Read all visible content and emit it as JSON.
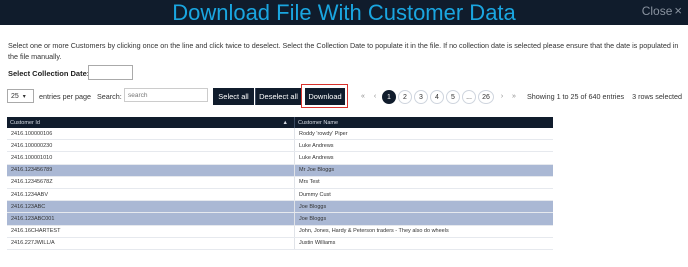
{
  "title": "Download File With Customer Data",
  "close_label": "Close",
  "intro_text": "Select one or more Customers by clicking once on the line and click twice to deselect. Select the Collection Date to populate it in the file. If no collection date is selected please ensure that the date is populated in the file manually.",
  "collection_date_label": "Select Collection Date:",
  "collection_date_value": "",
  "page_length": "25",
  "entries_per_page_label": "entries per page",
  "search_label": "Search:",
  "search_placeholder": "search",
  "buttons": {
    "select_all": "Select all",
    "deselect_all": "Deselect all",
    "download": "Download"
  },
  "pagination": {
    "first": "«",
    "prev": "‹",
    "pages": [
      "1",
      "2",
      "3",
      "4",
      "5",
      "...",
      "26"
    ],
    "active": "1",
    "next": "›",
    "last": "»"
  },
  "info_text": "Showing 1 to 25 of 640 entries",
  "selected_text": "3 rows selected",
  "columns": [
    "Customer Id",
    "Customer Name"
  ],
  "sort_indicator": "▲",
  "rows": [
    {
      "id": "2416.100000106",
      "name": "Roddy 'rowdy' Piper",
      "selected": false
    },
    {
      "id": "2416.100000230",
      "name": "Luke Andrews",
      "selected": false
    },
    {
      "id": "2416.100001010",
      "name": "Luke Andrews",
      "selected": false
    },
    {
      "id": "2416.123456789",
      "name": "Mr Joe Bloggs",
      "selected": true
    },
    {
      "id": "2416.12345678Z",
      "name": "Mrs Test",
      "selected": false
    },
    {
      "id": "2416.1234ABV",
      "name": "Dummy Cust",
      "selected": false
    },
    {
      "id": "2416.123ABC",
      "name": "Joe Bloggs",
      "selected": true
    },
    {
      "id": "2416.123ABC001",
      "name": "Joe Bloggs",
      "selected": true
    },
    {
      "id": "2416.16CHARTEST",
      "name": "John, Jones, Hardy & Peterson traders - They also do wheels",
      "selected": false
    },
    {
      "id": "2416.227JWILL/A",
      "name": "Justin Williams",
      "selected": false
    }
  ]
}
